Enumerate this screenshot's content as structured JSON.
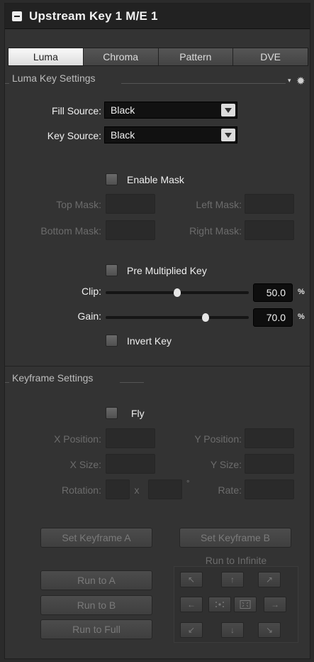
{
  "title": "Upstream Key 1 M/E 1",
  "tabs": [
    {
      "label": "Luma",
      "active": true
    },
    {
      "label": "Chroma",
      "active": false
    },
    {
      "label": "Pattern",
      "active": false
    },
    {
      "label": "DVE",
      "active": false
    }
  ],
  "luma": {
    "section_title": "Luma Key Settings",
    "fill_source_label": "Fill Source:",
    "fill_source_value": "Black",
    "key_source_label": "Key Source:",
    "key_source_value": "Black",
    "enable_mask_label": "Enable Mask",
    "enable_mask_checked": false,
    "top_mask_label": "Top Mask:",
    "left_mask_label": "Left Mask:",
    "bottom_mask_label": "Bottom Mask:",
    "right_mask_label": "Right Mask:",
    "pre_multiplied_label": "Pre Multiplied Key",
    "pre_multiplied_checked": false,
    "clip_label": "Clip:",
    "clip_value": "50.0",
    "clip_fraction": 0.5,
    "gain_label": "Gain:",
    "gain_value": "70.0",
    "gain_fraction": 0.7,
    "percent_unit": "%",
    "invert_key_label": "Invert Key",
    "invert_key_checked": false
  },
  "keyframe": {
    "section_title": "Keyframe Settings",
    "fly_label": "Fly",
    "fly_checked": false,
    "x_position_label": "X Position:",
    "y_position_label": "Y Position:",
    "x_size_label": "X Size:",
    "y_size_label": "Y Size:",
    "rotation_label": "Rotation:",
    "rotation_x": "x",
    "degree_symbol": "°",
    "rate_label": "Rate:",
    "set_keyframe_a": "Set Keyframe A",
    "set_keyframe_b": "Set Keyframe B",
    "run_to_a": "Run to A",
    "run_to_b": "Run to B",
    "run_to_full": "Run to Full",
    "run_to_infinite": "Run to Infinite",
    "arrows": {
      "up_left": "↖",
      "up": "↑",
      "up_right": "↗",
      "left": "←",
      "right": "→",
      "down_left": "↙",
      "down": "↓",
      "down_right": "↘"
    }
  },
  "colors": {
    "panel": "#333333",
    "titlebar": "#222222",
    "active_tab": "#ececec",
    "value_box": "#0e0e0e"
  }
}
